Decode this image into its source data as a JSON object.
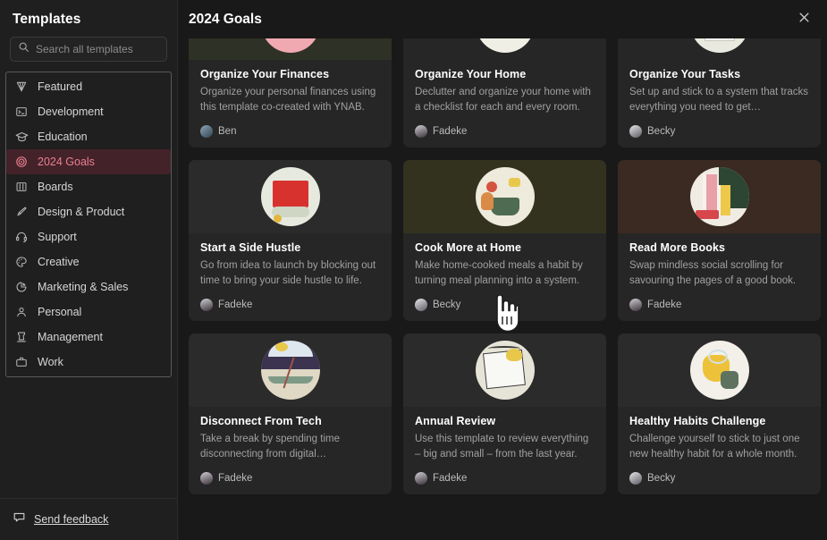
{
  "sidebar": {
    "title": "Templates",
    "search": {
      "placeholder": "Search all templates",
      "value": "",
      "icon": "search-icon"
    },
    "items": [
      {
        "label": "Featured",
        "icon": "diamond-icon",
        "active": false
      },
      {
        "label": "Development",
        "icon": "terminal-icon",
        "active": false
      },
      {
        "label": "Education",
        "icon": "graduation-cap-icon",
        "active": false
      },
      {
        "label": "2024 Goals",
        "icon": "target-icon",
        "active": true
      },
      {
        "label": "Boards",
        "icon": "columns-icon",
        "active": false
      },
      {
        "label": "Design & Product",
        "icon": "paintbrush-icon",
        "active": false
      },
      {
        "label": "Support",
        "icon": "headset-icon",
        "active": false
      },
      {
        "label": "Creative",
        "icon": "palette-icon",
        "active": false
      },
      {
        "label": "Marketing & Sales",
        "icon": "pie-chart-icon",
        "active": false
      },
      {
        "label": "Personal",
        "icon": "person-icon",
        "active": false
      },
      {
        "label": "Management",
        "icon": "rook-chess-icon",
        "active": false
      },
      {
        "label": "Work",
        "icon": "briefcase-icon",
        "active": false
      }
    ],
    "footer": {
      "label": "Send feedback",
      "icon": "comment-icon"
    }
  },
  "header": {
    "title": "2024 Goals",
    "close_label": "Close",
    "close_icon": "close-icon"
  },
  "colors": {
    "active_accent": "#e8818f",
    "active_bg": "#44222a",
    "panel_bg": "#1f1f1f",
    "main_bg": "#191919",
    "card_bg": "#262626"
  },
  "cards": [
    {
      "title": "Organize Your Finances",
      "desc": "Organize your personal finances using this template co-created with YNAB.",
      "author": "Ben",
      "thumb_bg": "#2e3126",
      "thumb_art": "pink-bowl",
      "partial": true
    },
    {
      "title": "Organize Your Home",
      "desc": "Declutter and organize your home with a checklist for each and every room.",
      "author": "Fadeke",
      "thumb_bg": "#262626",
      "thumb_art": "yellow-basket",
      "partial": true
    },
    {
      "title": "Organize Your Tasks",
      "desc": "Set up and stick to a system that tracks everything you need to get…",
      "author": "Becky",
      "thumb_bg": "#262626",
      "thumb_art": "white-page",
      "partial": true
    },
    {
      "title": "Start a Side Hustle",
      "desc": "Go from idea to launch by blocking out time to bring your side hustle to life.",
      "author": "Fadeke",
      "thumb_bg": "#2b2b2b",
      "thumb_art": "red-box",
      "partial": false
    },
    {
      "title": "Cook More at Home",
      "desc": "Make home-cooked meals a habit by turning meal planning into a system.",
      "author": "Becky",
      "thumb_bg": "#32321f",
      "thumb_art": "green-pot",
      "partial": false
    },
    {
      "title": "Read More Books",
      "desc": "Swap mindless social scrolling for savouring the pages of a good book.",
      "author": "Fadeke",
      "thumb_bg": "#3a2a22",
      "thumb_art": "books",
      "partial": false
    },
    {
      "title": "Disconnect From Tech",
      "desc": "Take a break by spending time disconnecting from digital…",
      "author": "Fadeke",
      "thumb_bg": "#2b2b2b",
      "thumb_art": "canoe-night",
      "partial": false
    },
    {
      "title": "Annual Review",
      "desc": "Use this template to review everything – big and small – from the last year.",
      "author": "Fadeke",
      "thumb_bg": "#2b2b2b",
      "thumb_art": "notebook",
      "partial": false
    },
    {
      "title": "Healthy Habits Challenge",
      "desc": "Challenge yourself to stick to just one new healthy habit for a whole month.",
      "author": "Becky",
      "thumb_bg": "#2b2b2b",
      "thumb_art": "lemon-jug",
      "partial": false
    }
  ]
}
